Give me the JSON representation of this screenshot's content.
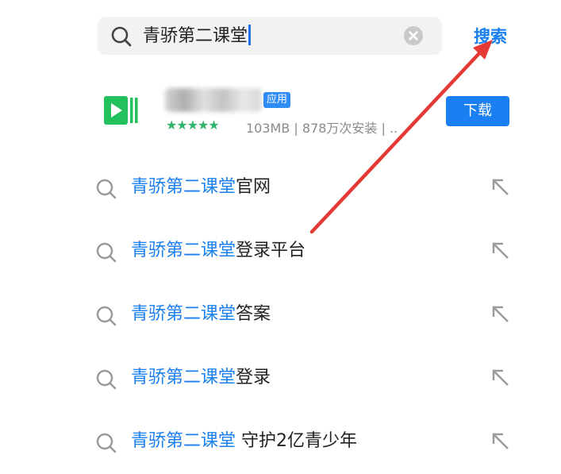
{
  "search": {
    "query": "青骄第二课堂",
    "submit_label": "搜索"
  },
  "app_result": {
    "badge": "应用",
    "stars": "★★★★★",
    "meta": "103MB | 878万次安装 | ..",
    "download_label": "下载",
    "icon_color": "#22c15e"
  },
  "suggestions": [
    {
      "highlight": "青骄第二课堂",
      "rest": "官网"
    },
    {
      "highlight": "青骄第二课堂",
      "rest": "登录平台"
    },
    {
      "highlight": "青骄第二课堂",
      "rest": "答案"
    },
    {
      "highlight": "青骄第二课堂",
      "rest": "登录"
    },
    {
      "highlight": "青骄第二课堂",
      "rest": " 守护2亿青少年"
    }
  ],
  "colors": {
    "accent": "#1a7ff0",
    "annotation_arrow": "#e53935",
    "rating": "#32b36b"
  }
}
